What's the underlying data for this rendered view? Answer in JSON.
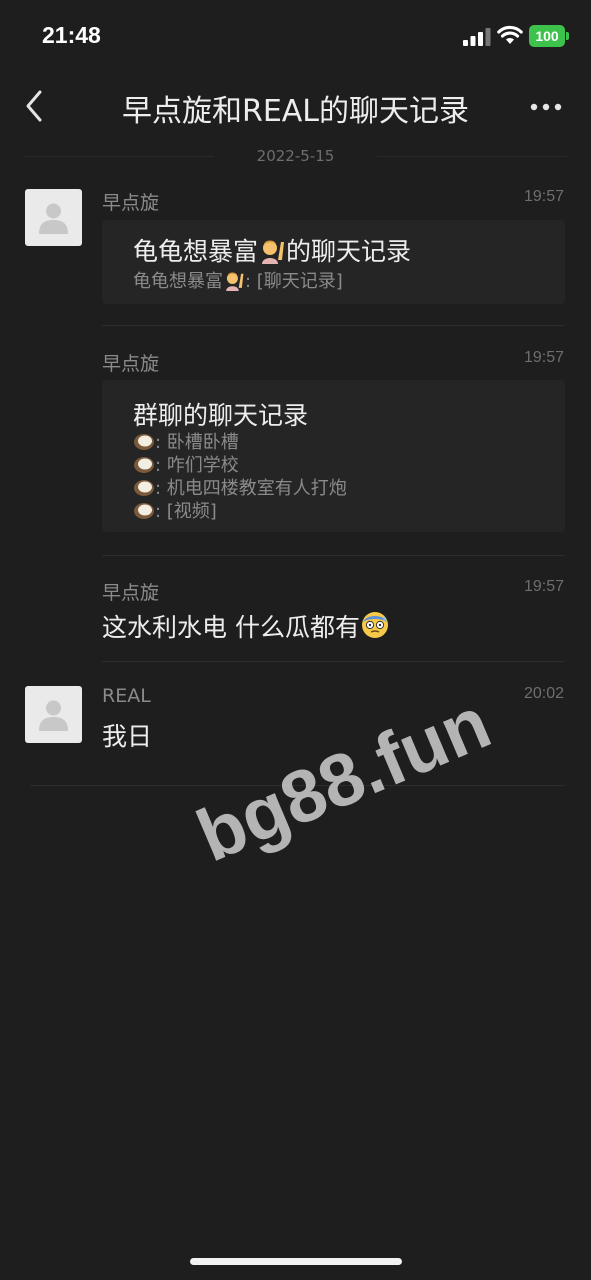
{
  "status_bar": {
    "time": "21:48",
    "battery": "100"
  },
  "nav": {
    "title": "早点旋和REAL的聊天记录"
  },
  "date_separator": "2022-5-15",
  "messages": [
    {
      "sender": "早点旋",
      "time": "19:57",
      "card": {
        "title_prefix": "龟龟想暴富",
        "title_suffix": "的聊天记录",
        "line_prefix": "龟龟想暴富",
        "line_suffix": ": [聊天记录]"
      }
    },
    {
      "sender": "早点旋",
      "time": "19:57",
      "card": {
        "title": "群聊的聊天记录",
        "lines": [
          ": 卧槽卧槽",
          ": 咋们学校",
          ": 机电四楼教室有人打炮",
          ": [视频]"
        ]
      }
    },
    {
      "sender": "早点旋",
      "time": "19:57",
      "text": "这水利水电 什么瓜都有"
    },
    {
      "sender": "REAL",
      "time": "20:02",
      "text": "我日"
    }
  ],
  "watermark": "bg88.fun",
  "icons": [
    "back-icon",
    "more-icon",
    "signal-icon",
    "wifi-icon",
    "battery-icon",
    "avatar-placeholder-icon",
    "person-raising-hand-emoji",
    "coconut-emoji",
    "cold-sweat-emoji"
  ]
}
